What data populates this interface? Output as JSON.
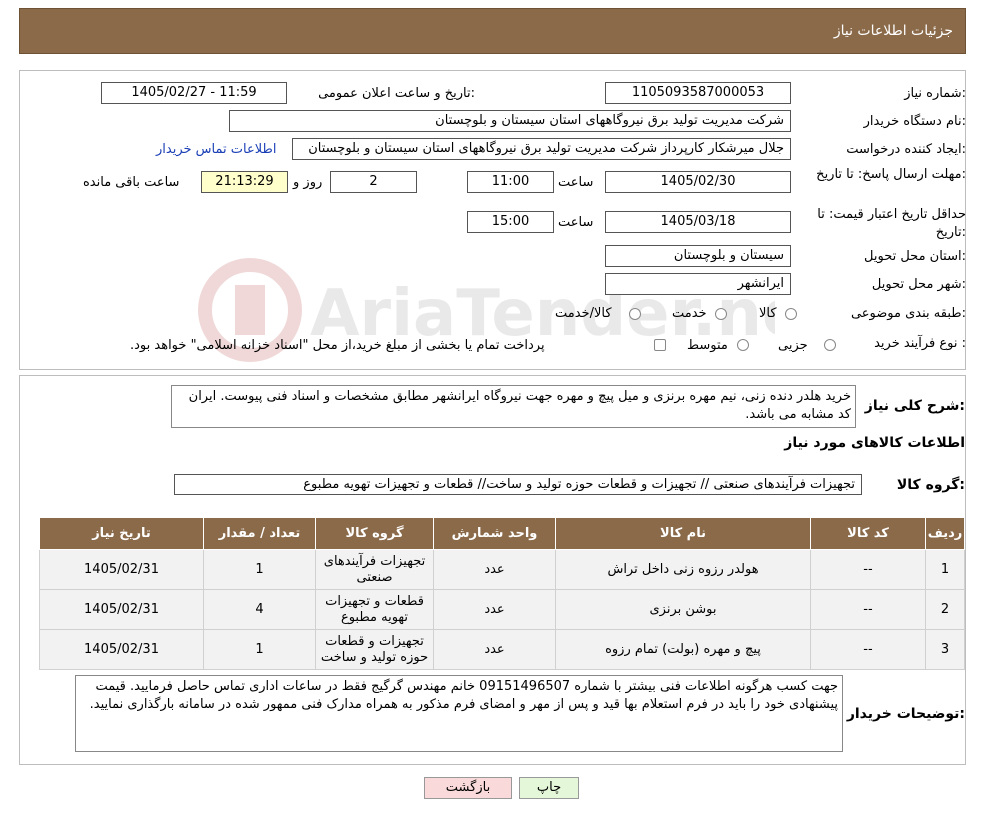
{
  "header": {
    "title": "جزئیات اطلاعات نیاز"
  },
  "form": {
    "need_number_label": "شماره نیاز:",
    "need_number": "1105093587000053",
    "announce_label": "تاریخ و ساعت اعلان عمومی:",
    "announce_value": "1405/02/27 - 11:59",
    "buyer_label": "نام دستگاه خریدار:",
    "buyer_value": "شرکت مدیریت تولید برق نیروگاههای استان سیستان و بلوچستان",
    "creator_label": "ایجاد کننده درخواست:",
    "creator_value": "جلال میرشکار کارپرداز شرکت مدیریت تولید برق نیروگاههای استان سیستان و بلوچستان",
    "contact_link": "اطلاعات تماس خریدار",
    "deadline_label": "مهلت ارسال پاسخ: تا تاریخ:",
    "deadline_date": "1405/02/30",
    "time_label": "ساعت",
    "deadline_time": "11:00",
    "days_value": "2",
    "days_label": "روز و",
    "remaining_time": "21:13:29",
    "remaining_label": "ساعت باقی مانده",
    "validity_label": "حداقل تاریخ اعتبار قیمت: تا تاریخ:",
    "validity_date": "1405/03/18",
    "validity_time": "15:00",
    "province_label": "استان محل تحویل:",
    "province_value": "سیستان و بلوچستان",
    "city_label": "شهر محل تحویل:",
    "city_value": "ایرانشهر",
    "category_label": "طبقه بندی موضوعی:",
    "category_options": [
      "کالا",
      "خدمت",
      "کالا/خدمت"
    ],
    "process_label": "نوع فرآیند خرید :",
    "process_options": [
      "جزیی",
      "متوسط"
    ],
    "process_note": "پرداخت تمام یا بخشی از مبلغ خرید،از محل \"اسناد خزانه اسلامی\" خواهد بود."
  },
  "description": {
    "label": "شرح کلی نیاز:",
    "text": "خرید هلدر دنده زنی، نیم مهره برنزی و میل پیچ و مهره جهت نیروگاه ایرانشهر مطابق مشخصات و اسناد فنی پیوست. ایران کد مشابه می باشد."
  },
  "goods_info": {
    "title": "اطلاعات کالاهای مورد نیاز",
    "group_label": "گروه کالا:",
    "group_value": "تجهیزات فرآیندهای صنعتی // تجهیزات و قطعات حوزه تولید و ساخت//  قطعات و تجهیزات تهویه مطبوع"
  },
  "table": {
    "headers": [
      "ردیف",
      "کد کالا",
      "نام کالا",
      "واحد شمارش",
      "گروه کالا",
      "تعداد / مقدار",
      "تاریخ نیاز"
    ],
    "rows": [
      [
        "1",
        "--",
        "هولدر رزوه زنی داخل تراش",
        "عدد",
        "تجهیزات فرآیندهای صنعتی",
        "1",
        "1405/02/31"
      ],
      [
        "2",
        "--",
        "بوشن برنزی",
        "عدد",
        "قطعات و تجهیزات تهویه مطبوع",
        "4",
        "1405/02/31"
      ],
      [
        "3",
        "--",
        "پیچ و مهره (بولت) تمام رزوه",
        "عدد",
        "تجهیزات و قطعات حوزه تولید و ساخت",
        "1",
        "1405/02/31"
      ]
    ]
  },
  "buyer_notes": {
    "label": "توضیحات خریدار:",
    "text": "جهت کسب هرگونه اطلاعات فنی بیشتر با شماره 09151496507 خانم مهندس گرگیج فقط در ساعات اداری تماس حاصل فرمایید. قیمت پیشنهادی خود را باید در فرم استعلام بها قید و پس از مهر و امضای فرم مذکور به همراه مدارک فنی ممهور شده در سامانه بارگذاری نمایید."
  },
  "buttons": {
    "print": "چاپ",
    "back": "بازگشت"
  },
  "watermark": "AriaTender.neT",
  "colors": {
    "header_bg": "#8b6a4a",
    "link": "#1a3fb5",
    "back_btn": "#f9d9d9",
    "print_btn": "#e4f7d9"
  }
}
